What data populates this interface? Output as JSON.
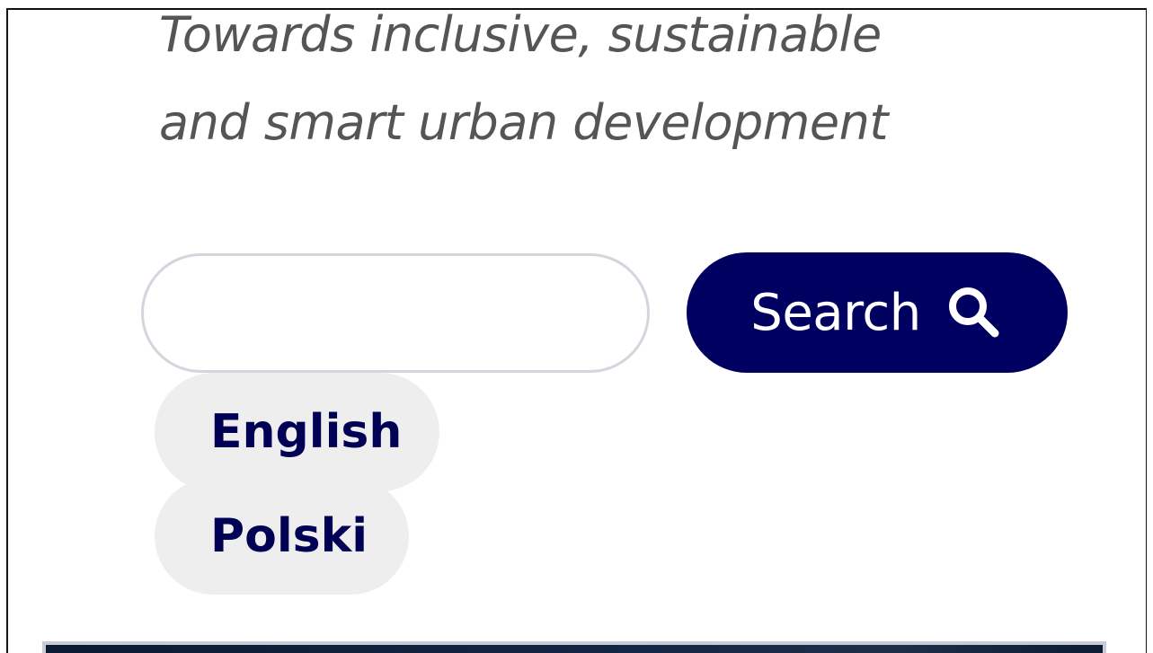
{
  "header": {
    "tagline_line1": "Towards inclusive, sustainable",
    "tagline_line2": "and smart urban development"
  },
  "search": {
    "input_value": "",
    "placeholder": "",
    "button_label": "Search",
    "button_icon": "search-icon"
  },
  "languages": {
    "items": [
      {
        "label": "English"
      },
      {
        "label": "Polski"
      }
    ]
  },
  "colors": {
    "brand_navy": "#000060",
    "tagline_gray": "#555555",
    "pill_bg": "#eeeeee",
    "input_border": "#d2d6dd"
  }
}
